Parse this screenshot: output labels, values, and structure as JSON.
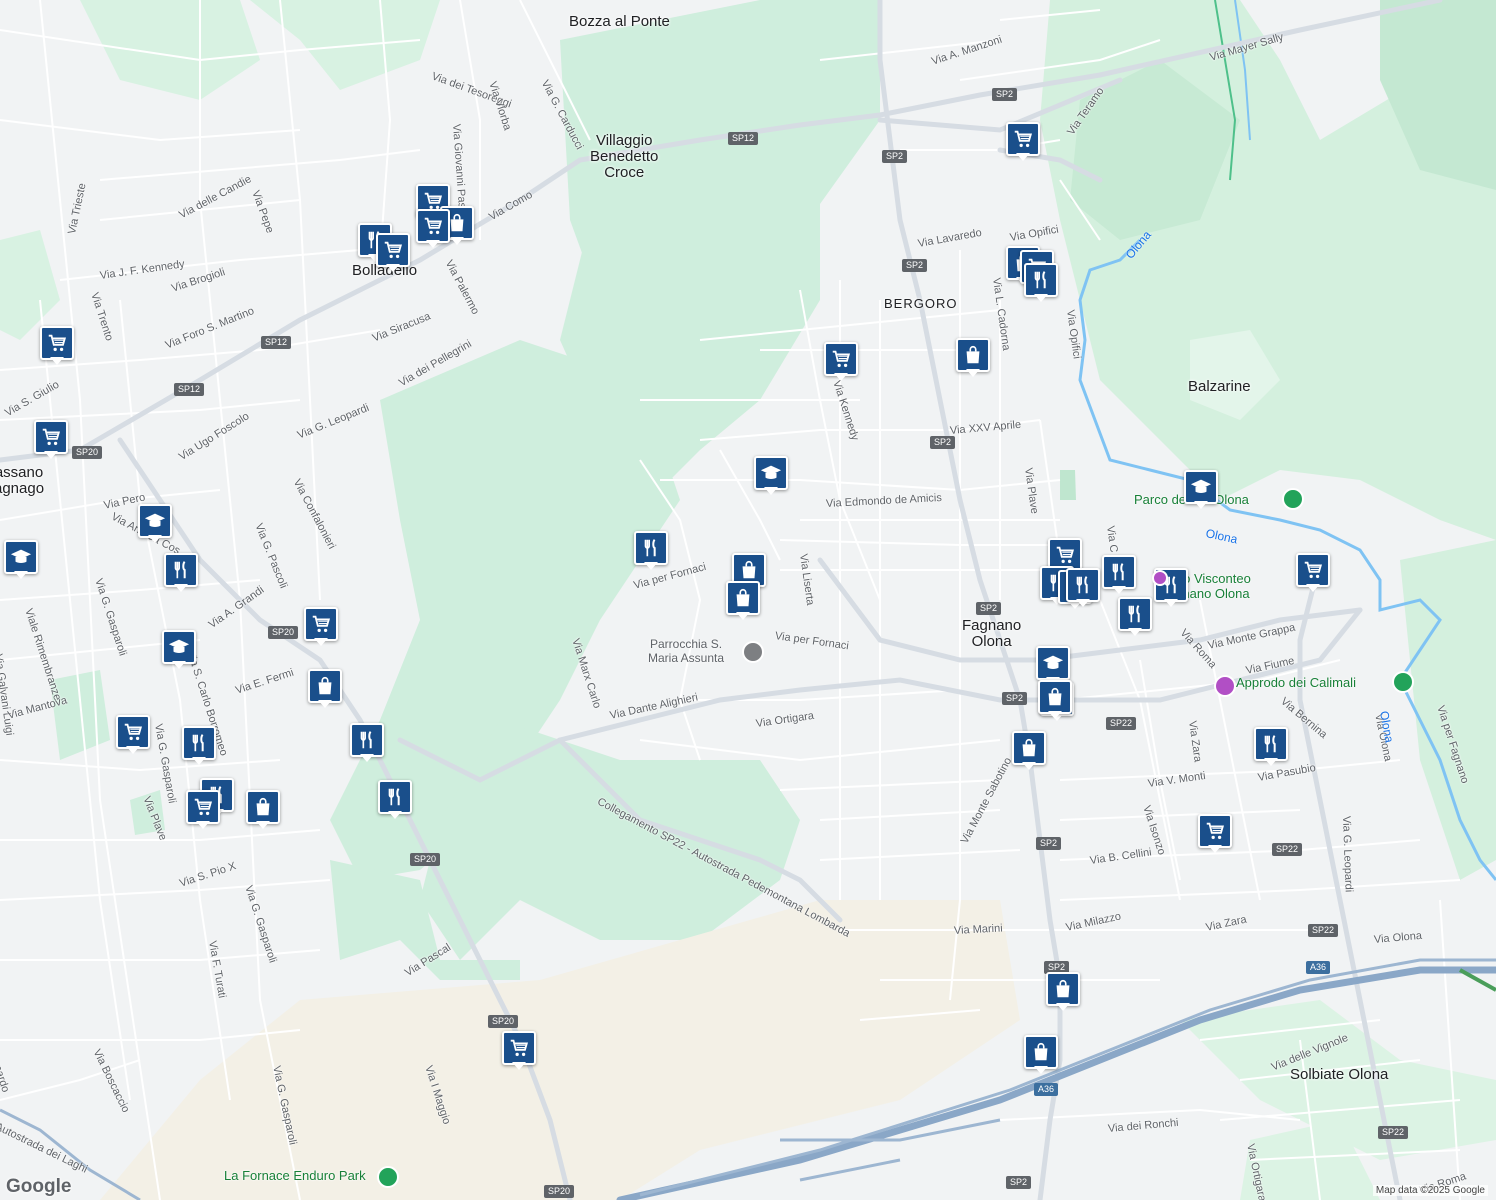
{
  "map": {
    "colors": {
      "land": "#f1f3f4",
      "green": "#cfeedd",
      "green_dark": "#bfe6cf",
      "water": "#7fc3f3",
      "road": "#ffffff",
      "road_major": "#c3ccd6",
      "motorway": "#8aa7c7",
      "poi": "#1a4f8b"
    },
    "places": [
      {
        "id": "bozza",
        "text": "Bozza al Ponte"
      },
      {
        "id": "villaggio",
        "text": "Villaggio\nBenedetto\nCroce"
      },
      {
        "id": "bolladello",
        "text": "Bolladello"
      },
      {
        "id": "bergoro",
        "text": "BERGORO"
      },
      {
        "id": "balzarine",
        "text": "Balzarine"
      },
      {
        "id": "fagnano",
        "text": "Fagnano\nOlona"
      },
      {
        "id": "solbiate",
        "text": "Solbiate Olona"
      },
      {
        "id": "cassano",
        "text": "assano\nagnago"
      }
    ],
    "streets": [
      {
        "id": "s1",
        "text": "Via A. Manzoni"
      },
      {
        "id": "s2",
        "text": "Via Mayer Sally"
      },
      {
        "id": "s3",
        "text": "Via dei Tesoreggi"
      },
      {
        "id": "s4",
        "text": "Via Vlorba"
      },
      {
        "id": "s5",
        "text": "Via G. Carducci"
      },
      {
        "id": "s6",
        "text": "Via Giovanni Pascoli"
      },
      {
        "id": "s7",
        "text": "Via Teramo"
      },
      {
        "id": "s8",
        "text": "Via delle Candie"
      },
      {
        "id": "s9",
        "text": "Via Pepe"
      },
      {
        "id": "s10",
        "text": "Via Como"
      },
      {
        "id": "s11",
        "text": "Via Trieste"
      },
      {
        "id": "s12",
        "text": "Via Lavaredo"
      },
      {
        "id": "s13",
        "text": "Via Opifici"
      },
      {
        "id": "s14",
        "text": "Via J. F. Kennedy"
      },
      {
        "id": "s15",
        "text": "Via Brogioli"
      },
      {
        "id": "s16",
        "text": "Via Palermo"
      },
      {
        "id": "s17",
        "text": "Via Trento"
      },
      {
        "id": "s18",
        "text": "Via Foro S. Martino"
      },
      {
        "id": "s19",
        "text": "Via Siracusa"
      },
      {
        "id": "s20",
        "text": "Via dei Pellegrini"
      },
      {
        "id": "s21",
        "text": "Via L. Cadorna"
      },
      {
        "id": "s22",
        "text": "Via Opifici"
      },
      {
        "id": "s23",
        "text": "Via Kennedy"
      },
      {
        "id": "s24",
        "text": "Via G. Leopardi"
      },
      {
        "id": "s25",
        "text": "Via Ugo Foscolo"
      },
      {
        "id": "s26",
        "text": "Via XXV Aprile"
      },
      {
        "id": "s27",
        "text": "Via Plave"
      },
      {
        "id": "s28",
        "text": "Via Confalonieri"
      },
      {
        "id": "s29",
        "text": "Via Pero"
      },
      {
        "id": "s30",
        "text": "Via Edmondo de Amicis"
      },
      {
        "id": "s31",
        "text": "Via Andrea Cos"
      },
      {
        "id": "s32",
        "text": "Via G. Pascoli"
      },
      {
        "id": "s33",
        "text": "Via per Fornaci"
      },
      {
        "id": "s34",
        "text": "Via Liserta"
      },
      {
        "id": "s35",
        "text": "Via G. Gasparoli"
      },
      {
        "id": "s36",
        "text": "Viale Rimembranze"
      },
      {
        "id": "s37",
        "text": "Via A. Grandi"
      },
      {
        "id": "s38",
        "text": "Via Galvani Luigi"
      },
      {
        "id": "s39",
        "text": "Via Marx Carlo"
      },
      {
        "id": "s40",
        "text": "Via per Fornaci"
      },
      {
        "id": "s41",
        "text": "Via Monte Grappa"
      },
      {
        "id": "s42",
        "text": "Via Roma"
      },
      {
        "id": "s43",
        "text": "Via S. Carlo Borromeo"
      },
      {
        "id": "s44",
        "text": "Via E. Fermi"
      },
      {
        "id": "s45",
        "text": "Via Fiume"
      },
      {
        "id": "s46",
        "text": "Via Mantova"
      },
      {
        "id": "s47",
        "text": "Via Dante Alighieri"
      },
      {
        "id": "s48",
        "text": "Via Ortigara"
      },
      {
        "id": "s49",
        "text": "Via Bernina"
      },
      {
        "id": "s50",
        "text": "Via Zara"
      },
      {
        "id": "s51",
        "text": "Via G. Gasparoli"
      },
      {
        "id": "s52",
        "text": "Via Pasubio"
      },
      {
        "id": "s53",
        "text": "Via V. Monti"
      },
      {
        "id": "s54",
        "text": "Via Monte Sabotino"
      },
      {
        "id": "s55",
        "text": "Via Isonzo"
      },
      {
        "id": "s56",
        "text": "Via Plave"
      },
      {
        "id": "s57",
        "text": "Collegamento SP22 - Autostrada Pedemontana Lombarda"
      },
      {
        "id": "s58",
        "text": "Via S. Pio X"
      },
      {
        "id": "s59",
        "text": "Via B. Cellini"
      },
      {
        "id": "s60",
        "text": "Via G. Leopardi"
      },
      {
        "id": "s61",
        "text": "Via G. Gasparoli"
      },
      {
        "id": "s62",
        "text": "Via F. Turati"
      },
      {
        "id": "s63",
        "text": "Via Marini"
      },
      {
        "id": "s64",
        "text": "Via Milazzo"
      },
      {
        "id": "s65",
        "text": "Via Zara"
      },
      {
        "id": "s66",
        "text": "Via Olona"
      },
      {
        "id": "s67",
        "text": "Via Pascal"
      },
      {
        "id": "s68",
        "text": "Via delle Vignole"
      },
      {
        "id": "s69",
        "text": "Via Boscaccio"
      },
      {
        "id": "s70",
        "text": "Via G. Gasparoli"
      },
      {
        "id": "s71",
        "text": "Via I Maggio"
      },
      {
        "id": "s72",
        "text": "Via dei Ronchi"
      },
      {
        "id": "s73",
        "text": "Via Ortigara"
      },
      {
        "id": "s74",
        "text": "Via Roma"
      },
      {
        "id": "s75",
        "text": "Via per Fagnano"
      },
      {
        "id": "s76",
        "text": "Autostrada dei Laghi"
      },
      {
        "id": "s77",
        "text": "Via Olona"
      },
      {
        "id": "s78",
        "text": "Via S. Giulio"
      },
      {
        "id": "s79",
        "text": "ernardo"
      },
      {
        "id": "s80",
        "text": "Via C"
      }
    ],
    "shields": [
      {
        "id": "sh1",
        "text": "SP2"
      },
      {
        "id": "sh2",
        "text": "SP12"
      },
      {
        "id": "sh3",
        "text": "SP2"
      },
      {
        "id": "sh4",
        "text": "SP2"
      },
      {
        "id": "sh5",
        "text": "SP12"
      },
      {
        "id": "sh6",
        "text": "SP12"
      },
      {
        "id": "sh7",
        "text": "SP2"
      },
      {
        "id": "sh8",
        "text": "SP20"
      },
      {
        "id": "sh9",
        "text": "SP20"
      },
      {
        "id": "sh10",
        "text": "SP2"
      },
      {
        "id": "sh11",
        "text": "SP2"
      },
      {
        "id": "sh12",
        "text": "SP22"
      },
      {
        "id": "sh13",
        "text": "SP2"
      },
      {
        "id": "sh14",
        "text": "SP20"
      },
      {
        "id": "sh15",
        "text": "SP22"
      },
      {
        "id": "sh16",
        "text": "SP22"
      },
      {
        "id": "sh17",
        "text": "SP2"
      },
      {
        "id": "sh18",
        "text": "SP20"
      },
      {
        "id": "sh19",
        "text": "A36"
      },
      {
        "id": "sh20",
        "text": "A36"
      },
      {
        "id": "sh21",
        "text": "SP22"
      },
      {
        "id": "sh22",
        "text": "SP2"
      },
      {
        "id": "sh23",
        "text": "SP20"
      }
    ],
    "landmarks": [
      {
        "id": "church",
        "text": "Parrocchia S.\nMaria Assunta"
      },
      {
        "id": "parco",
        "text": "Parco de    io Olona"
      },
      {
        "id": "castello",
        "text": "stello Visconteo\nFagnano Olona"
      },
      {
        "id": "approdo",
        "text": "Approdo dei Calimali"
      },
      {
        "id": "fornace",
        "text": "La Fornace Enduro Park"
      }
    ],
    "water_labels": [
      {
        "id": "w1",
        "text": "Olona"
      },
      {
        "id": "w2",
        "text": "Olona"
      },
      {
        "id": "w3",
        "text": "Olona"
      }
    ],
    "pois": [
      {
        "type": "cart-icon"
      },
      {
        "type": "cart-icon"
      },
      {
        "type": "bag-icon"
      },
      {
        "type": "cart-icon"
      },
      {
        "type": "fork-knife-icon"
      },
      {
        "type": "cart-icon"
      },
      {
        "type": "cart-icon"
      },
      {
        "type": "bag-icon"
      },
      {
        "type": "cart-icon"
      },
      {
        "type": "fork-knife-icon"
      },
      {
        "type": "cart-icon"
      },
      {
        "type": "bag-icon"
      },
      {
        "type": "cart-icon"
      },
      {
        "type": "graduation-cap-icon"
      },
      {
        "type": "graduation-cap-icon"
      },
      {
        "type": "graduation-cap-icon"
      },
      {
        "type": "graduation-cap-icon"
      },
      {
        "type": "fork-knife-icon"
      },
      {
        "type": "fork-knife-icon"
      },
      {
        "type": "bag-icon"
      },
      {
        "type": "cart-icon"
      },
      {
        "type": "graduation-cap-icon"
      },
      {
        "type": "cart-icon"
      },
      {
        "type": "fork-knife-icon"
      },
      {
        "type": "cart-icon"
      },
      {
        "type": "fork-knife-icon"
      },
      {
        "type": "bag-icon"
      },
      {
        "type": "bag-icon"
      },
      {
        "type": "fork-knife-icon"
      },
      {
        "type": "graduation-cap-icon"
      },
      {
        "type": "cart-icon"
      },
      {
        "type": "fork-knife-icon"
      },
      {
        "type": "fork-knife-icon"
      },
      {
        "type": "fork-knife-icon"
      },
      {
        "type": "fork-knife-icon"
      },
      {
        "type": "fork-knife-icon"
      },
      {
        "type": "fork-knife-icon"
      },
      {
        "type": "fork-knife-icon"
      },
      {
        "type": "bag-icon"
      },
      {
        "type": "cart-icon"
      },
      {
        "type": "bag-icon"
      },
      {
        "type": "fork-knife-icon"
      },
      {
        "type": "cart-icon"
      },
      {
        "type": "bag-icon"
      },
      {
        "type": "bag-icon"
      },
      {
        "type": "bag-icon"
      },
      {
        "type": "cart-icon"
      },
      {
        "type": "cart-icon"
      }
    ],
    "logo": "Google",
    "attribution": "Map data ©2025 Google"
  }
}
